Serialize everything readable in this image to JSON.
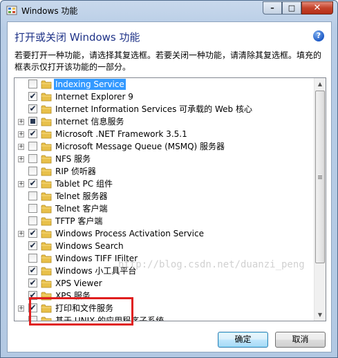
{
  "window": {
    "title": "Windows 功能"
  },
  "caption_buttons": {
    "minimize": "–",
    "maximize": "□",
    "close": "✕"
  },
  "heading": "打开或关闭 Windows 功能",
  "help": "?",
  "description": "若要打开一种功能，请选择其复选框。若要关闭一种功能，请清除其复选框。填充的框表示仅打开该功能的一部分。",
  "features": [
    {
      "label": "Indexing Service",
      "state": "unchecked",
      "expandable": false,
      "selected": true
    },
    {
      "label": "Internet Explorer 9",
      "state": "checked",
      "expandable": false,
      "selected": false
    },
    {
      "label": "Internet Information Services 可承载的 Web 核心",
      "state": "checked",
      "expandable": false,
      "selected": false
    },
    {
      "label": "Internet 信息服务",
      "state": "partial",
      "expandable": true,
      "selected": false
    },
    {
      "label": "Microsoft .NET Framework 3.5.1",
      "state": "checked",
      "expandable": true,
      "selected": false
    },
    {
      "label": "Microsoft Message Queue (MSMQ) 服务器",
      "state": "unchecked",
      "expandable": true,
      "selected": false
    },
    {
      "label": "NFS 服务",
      "state": "unchecked",
      "expandable": true,
      "selected": false
    },
    {
      "label": "RIP 侦听器",
      "state": "unchecked",
      "expandable": false,
      "selected": false
    },
    {
      "label": "Tablet PC 组件",
      "state": "checked",
      "expandable": true,
      "selected": false
    },
    {
      "label": "Telnet 服务器",
      "state": "unchecked",
      "expandable": false,
      "selected": false
    },
    {
      "label": "Telnet 客户端",
      "state": "unchecked",
      "expandable": false,
      "selected": false
    },
    {
      "label": "TFTP 客户端",
      "state": "unchecked",
      "expandable": false,
      "selected": false
    },
    {
      "label": "Windows Process Activation Service",
      "state": "checked",
      "expandable": true,
      "selected": false
    },
    {
      "label": "Windows Search",
      "state": "checked",
      "expandable": false,
      "selected": false
    },
    {
      "label": "Windows TIFF IFilter",
      "state": "unchecked",
      "expandable": false,
      "selected": false
    },
    {
      "label": "Windows 小工具平台",
      "state": "checked",
      "expandable": false,
      "selected": false
    },
    {
      "label": "XPS Viewer",
      "state": "checked",
      "expandable": false,
      "selected": false
    },
    {
      "label": "XPS 服务",
      "state": "checked",
      "expandable": false,
      "selected": false
    },
    {
      "label": "打印和文件服务",
      "state": "checked",
      "expandable": true,
      "selected": false
    },
    {
      "label": "基于 UNIX 的应用程序子系统",
      "state": "unchecked",
      "expandable": false,
      "selected": false
    }
  ],
  "watermark": "http://blog.csdn.net/duanzi_peng",
  "buttons": {
    "ok": "确定",
    "cancel": "取消"
  },
  "colors": {
    "heading": "#1e3287",
    "selection": "#3399ff",
    "highlight_box": "#e01e1e",
    "folder": "#e8c04a"
  }
}
